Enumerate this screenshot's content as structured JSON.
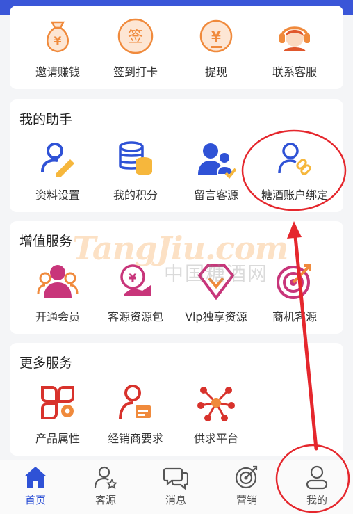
{
  "colors": {
    "accent_blue": "#2f52d6",
    "header_blue": "#3a56d8",
    "orange": "#f08a3c",
    "red": "#d8322c",
    "magenta": "#c8357a",
    "annotation_red": "#e5272d"
  },
  "quick_actions": [
    {
      "label": "邀请赚钱",
      "icon": "money-bag-icon"
    },
    {
      "label": "签到打卡",
      "icon": "checkin-icon"
    },
    {
      "label": "提现",
      "icon": "withdraw-icon"
    },
    {
      "label": "联系客服",
      "icon": "customer-service-icon"
    }
  ],
  "assistant": {
    "title": "我的助手",
    "items": [
      {
        "label": "资料设置",
        "icon": "profile-edit-icon"
      },
      {
        "label": "我的积分",
        "icon": "points-icon"
      },
      {
        "label": "留言客源",
        "icon": "message-customer-icon"
      },
      {
        "label": "糖酒账户绑定",
        "icon": "account-link-icon"
      }
    ]
  },
  "value_services": {
    "title": "增值服务",
    "items": [
      {
        "label": "开通会员",
        "icon": "membership-icon"
      },
      {
        "label": "客源资源包",
        "icon": "resource-pack-icon"
      },
      {
        "label": "Vip独享资源",
        "icon": "vip-diamond-icon"
      },
      {
        "label": "商机客源",
        "icon": "target-icon"
      }
    ]
  },
  "more_services": {
    "title": "更多服务",
    "items": [
      {
        "label": "产品属性",
        "icon": "product-attributes-icon"
      },
      {
        "label": "经销商要求",
        "icon": "dealer-requirements-icon"
      },
      {
        "label": "供求平台",
        "icon": "supply-demand-icon"
      }
    ]
  },
  "watermark": {
    "logo": "TangJiu.com",
    "text": "中国糖酒网"
  },
  "tabbar": {
    "items": [
      {
        "label": "首页",
        "icon": "home-icon",
        "active": true
      },
      {
        "label": "客源",
        "icon": "customer-source-icon",
        "active": false
      },
      {
        "label": "消息",
        "icon": "message-icon",
        "active": false
      },
      {
        "label": "营销",
        "icon": "marketing-target-icon",
        "active": false
      },
      {
        "label": "我的",
        "icon": "profile-icon",
        "active": false
      }
    ]
  }
}
